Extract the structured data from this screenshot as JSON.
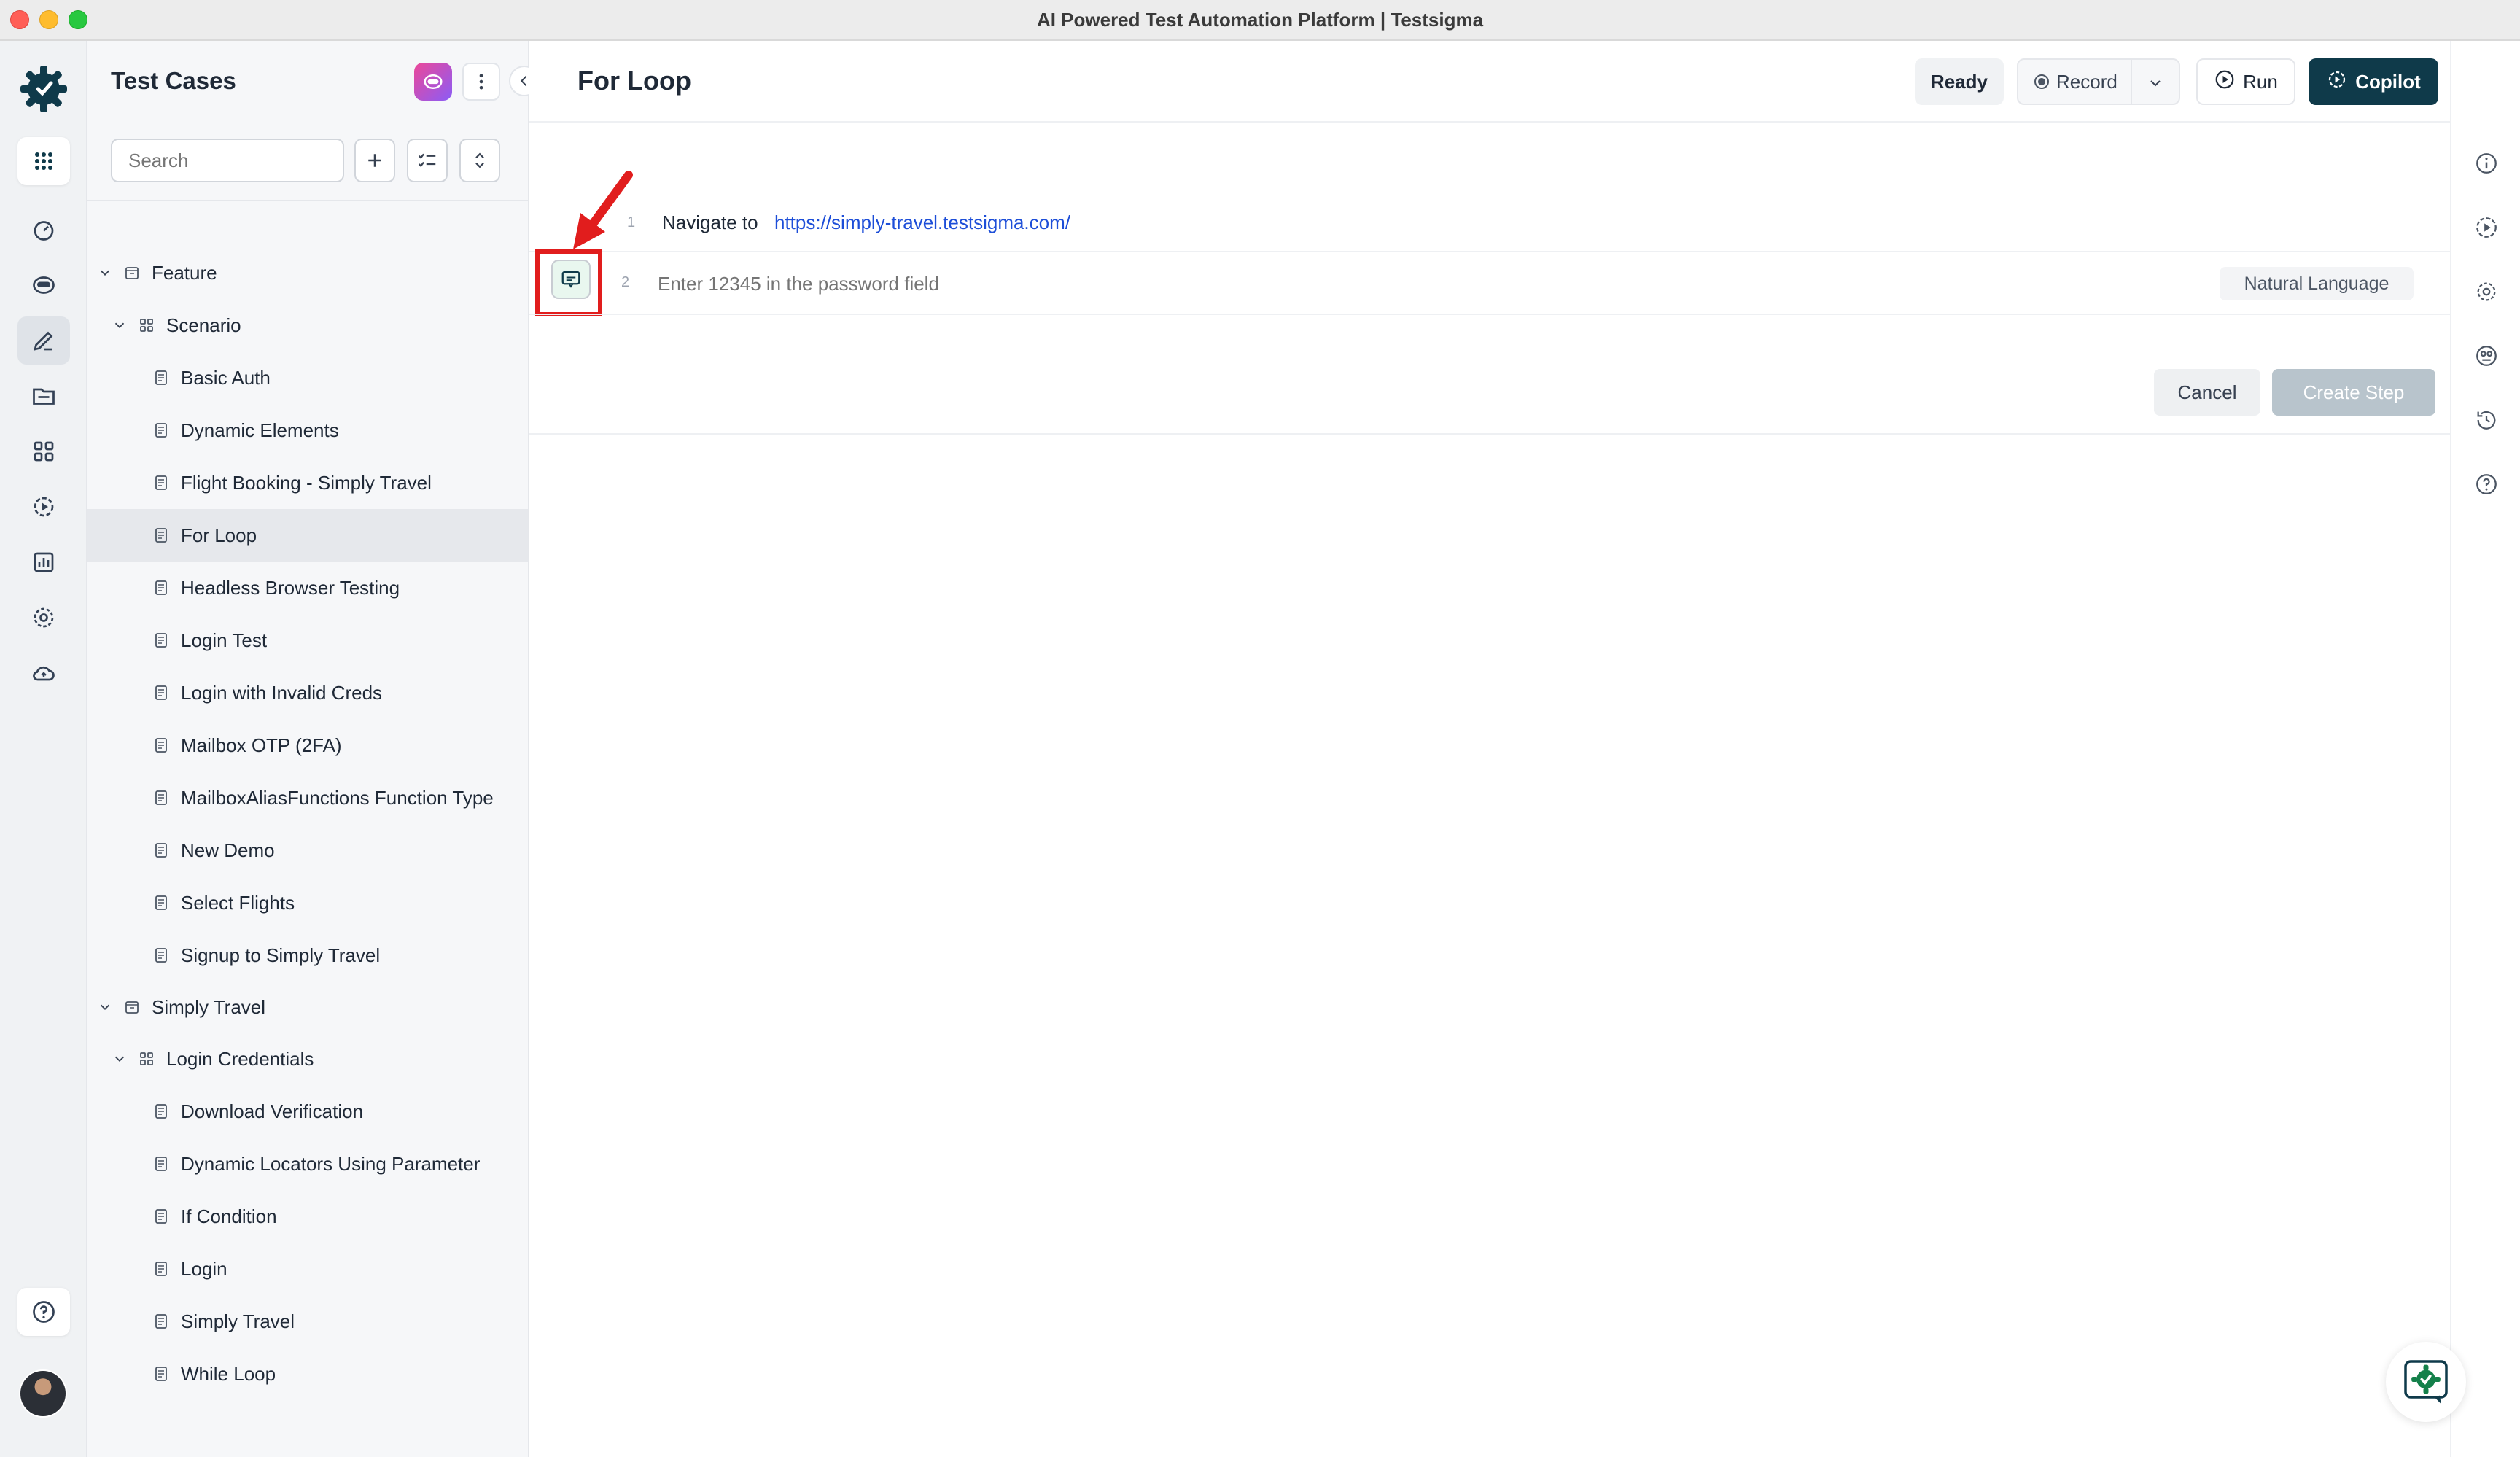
{
  "window": {
    "title": "AI Powered Test Automation Platform | Testsigma"
  },
  "rail": {
    "icons": [
      "apps-grid-icon",
      "dashboard-icon",
      "ai-agent-icon",
      "test-cases-icon",
      "folder-icon",
      "modules-icon",
      "test-runs-icon",
      "reports-icon",
      "settings-icon",
      "cloud-icon",
      "help-icon"
    ]
  },
  "sidebar": {
    "title": "Test Cases",
    "search_placeholder": "Search",
    "tree": [
      {
        "label": "Feature",
        "type": "feature",
        "level": 0,
        "expanded": true
      },
      {
        "label": "Scenario",
        "type": "scenario",
        "level": 1,
        "expanded": true
      },
      {
        "label": "Basic Auth",
        "type": "case",
        "level": 2
      },
      {
        "label": "Dynamic Elements",
        "type": "case",
        "level": 2
      },
      {
        "label": "Flight Booking - Simply Travel",
        "type": "case",
        "level": 2
      },
      {
        "label": "For Loop",
        "type": "case",
        "level": 2,
        "selected": true
      },
      {
        "label": "Headless Browser Testing",
        "type": "case",
        "level": 2
      },
      {
        "label": "Login Test",
        "type": "case",
        "level": 2
      },
      {
        "label": "Login with Invalid Creds",
        "type": "case",
        "level": 2
      },
      {
        "label": "Mailbox OTP (2FA)",
        "type": "case",
        "level": 2
      },
      {
        "label": "MailboxAliasFunctions Function Type",
        "type": "case",
        "level": 2
      },
      {
        "label": "New Demo",
        "type": "case",
        "level": 2
      },
      {
        "label": "Select Flights",
        "type": "case",
        "level": 2
      },
      {
        "label": "Signup to Simply Travel",
        "type": "case",
        "level": 2
      },
      {
        "label": "Simply Travel",
        "type": "feature",
        "level": 0,
        "expanded": true
      },
      {
        "label": "Login Credentials",
        "type": "scenario",
        "level": 1,
        "expanded": true
      },
      {
        "label": "Download Verification",
        "type": "case",
        "level": 2
      },
      {
        "label": "Dynamic Locators Using Parameter",
        "type": "case",
        "level": 2
      },
      {
        "label": "If Condition",
        "type": "case",
        "level": 2
      },
      {
        "label": "Login",
        "type": "case",
        "level": 2
      },
      {
        "label": "Simply Travel",
        "type": "case",
        "level": 2
      },
      {
        "label": "While Loop",
        "type": "case",
        "level": 2
      }
    ]
  },
  "header": {
    "title": "For Loop",
    "ready_label": "Ready",
    "record_label": "Record",
    "run_label": "Run",
    "copilot_label": "Copilot"
  },
  "steps": {
    "step1": {
      "number": "1",
      "action": "Navigate to",
      "url": "https://simply-travel.testsigma.com/"
    },
    "step2": {
      "number": "2",
      "placeholder": "Enter 12345 in the password field",
      "mode": "Natural Language"
    },
    "cancel_label": "Cancel",
    "create_label": "Create Step"
  },
  "colors": {
    "brand_dark": "#0f3a4a",
    "link": "#1d4ed8",
    "highlight": "#e11d1d"
  }
}
